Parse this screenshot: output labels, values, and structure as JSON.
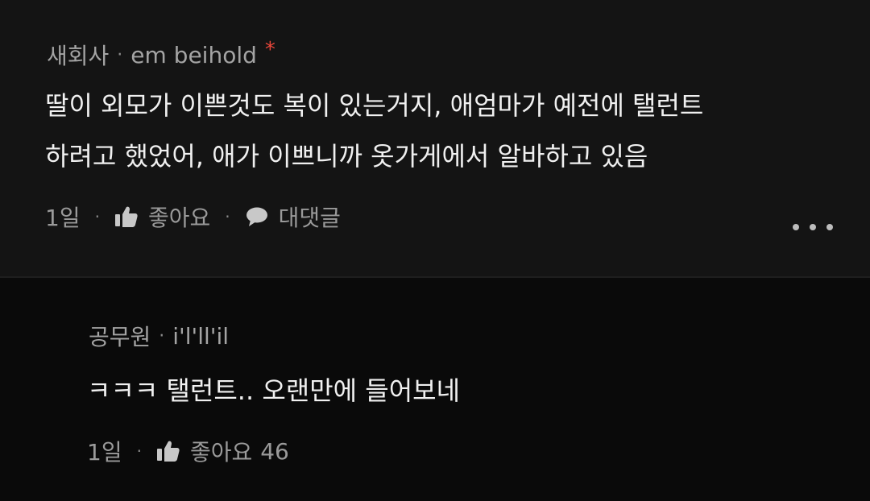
{
  "comments": [
    {
      "company": "새회사",
      "author": "em beihold",
      "author_mark": "*",
      "lines": [
        "딸이 외모가 이쁜것도 복이 있는거지, 애엄마가 예전에 탤런트",
        "하려고 했었어, 애가 이쁘니까 옷가게에서 알바하고 있음"
      ],
      "time": "1일",
      "like_label": "좋아요",
      "reply_label": "대댓글"
    },
    {
      "company": "공무원",
      "author": "i'l'll'il",
      "lines": [
        "ㅋㅋㅋ 탤런트.. 오랜만에 들어보네"
      ],
      "time": "1일",
      "like_label": "좋아요",
      "like_count": "46"
    }
  ],
  "icons": {
    "like": "thumbs-up-icon",
    "reply": "speech-bubble-icon",
    "more": "more-horizontal-icon"
  },
  "colors": {
    "background": "#0a0a0a",
    "card": "#141414",
    "text": "#f0f0f0",
    "meta": "#a4a4a4",
    "accent_star": "#e8463a"
  }
}
